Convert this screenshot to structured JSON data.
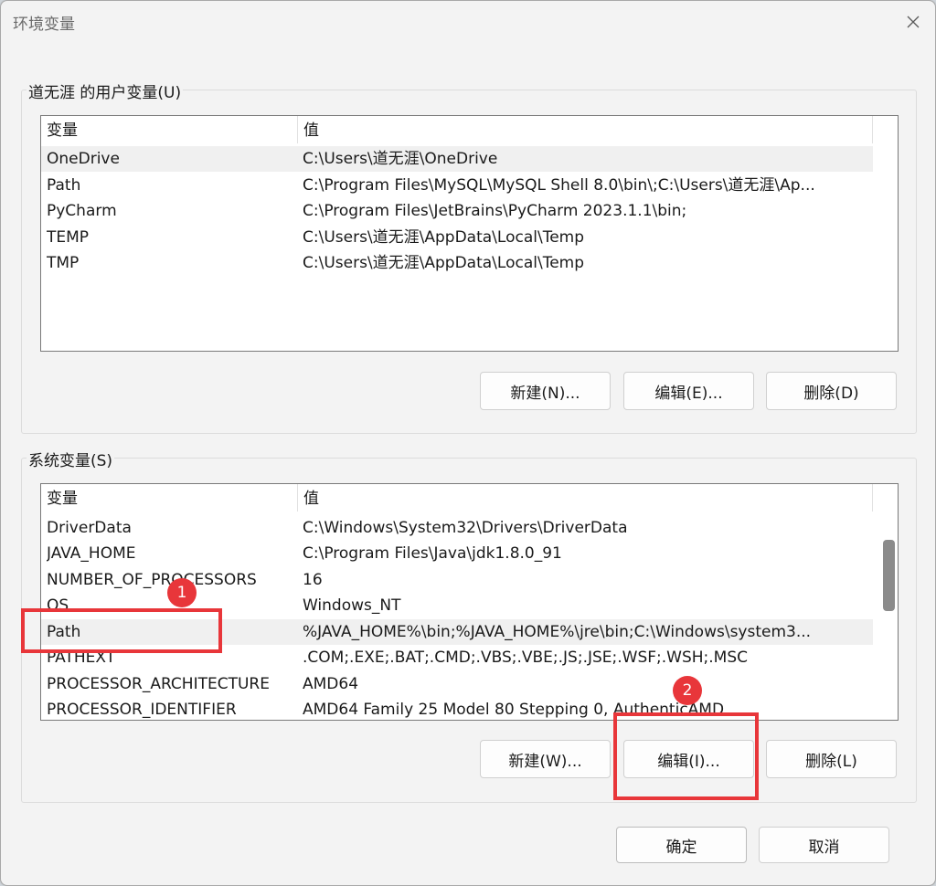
{
  "window": {
    "title": "环境变量"
  },
  "user_vars": {
    "label": "道无涯 的用户变量(U)",
    "columns": [
      "变量",
      "值"
    ],
    "rows": [
      {
        "name": "OneDrive",
        "value": "C:\\Users\\道无涯\\OneDrive"
      },
      {
        "name": "Path",
        "value": "C:\\Program Files\\MySQL\\MySQL Shell 8.0\\bin\\;C:\\Users\\道无涯\\Ap..."
      },
      {
        "name": "PyCharm",
        "value": "C:\\Program Files\\JetBrains\\PyCharm 2023.1.1\\bin;"
      },
      {
        "name": "TEMP",
        "value": "C:\\Users\\道无涯\\AppData\\Local\\Temp"
      },
      {
        "name": "TMP",
        "value": "C:\\Users\\道无涯\\AppData\\Local\\Temp"
      }
    ],
    "buttons": {
      "new": "新建(N)...",
      "edit": "编辑(E)...",
      "delete": "删除(D)"
    }
  },
  "sys_vars": {
    "label": "系统变量(S)",
    "columns": [
      "变量",
      "值"
    ],
    "rows": [
      {
        "name": "DriverData",
        "value": "C:\\Windows\\System32\\Drivers\\DriverData"
      },
      {
        "name": "JAVA_HOME",
        "value": "C:\\Program Files\\Java\\jdk1.8.0_91"
      },
      {
        "name": "NUMBER_OF_PROCESSORS",
        "value": "16"
      },
      {
        "name": "OS",
        "value": "Windows_NT"
      },
      {
        "name": "Path",
        "value": "%JAVA_HOME%\\bin;%JAVA_HOME%\\jre\\bin;C:\\Windows\\system3..."
      },
      {
        "name": "PATHEXT",
        "value": ".COM;.EXE;.BAT;.CMD;.VBS;.VBE;.JS;.JSE;.WSF;.WSH;.MSC"
      },
      {
        "name": "PROCESSOR_ARCHITECTURE",
        "value": "AMD64"
      },
      {
        "name": "PROCESSOR_IDENTIFIER",
        "value": "AMD64 Family 25 Model 80 Stepping 0, AuthenticAMD"
      }
    ],
    "buttons": {
      "new": "新建(W)...",
      "edit": "编辑(I)...",
      "delete": "删除(L)"
    }
  },
  "footer": {
    "ok": "确定",
    "cancel": "取消"
  },
  "annotations": {
    "step1": "1",
    "step2": "2"
  },
  "colors": {
    "annotation_red": "#e8363a",
    "selected_row": "#f0f0f0"
  }
}
